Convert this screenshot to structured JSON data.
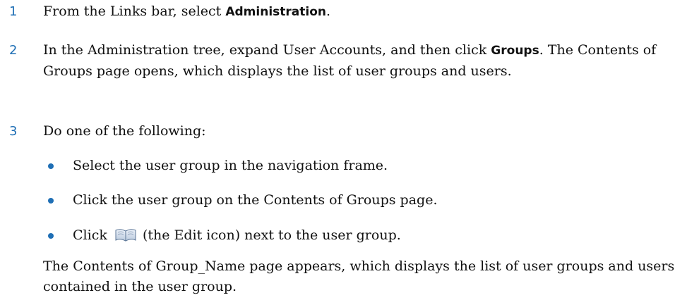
{
  "steps": [
    {
      "number": "1",
      "text_before": "From the Links bar, select ",
      "ui_term": "Administration",
      "text_after": "."
    },
    {
      "number": "2",
      "text_before": "In the Administration tree, expand User Accounts, and then click ",
      "ui_term": "Groups",
      "text_after": ". The Contents of Groups page opens, which displays the list of user groups and users."
    },
    {
      "number": "3",
      "text": "Do one of the following:"
    }
  ],
  "bullets": [
    {
      "text": "Select the user group in the navigation frame."
    },
    {
      "text": "Click the user group on the Contents of Groups page."
    },
    {
      "text_before": "Click",
      "icon": "edit-icon",
      "text_after": "(the Edit icon) next to the user group."
    }
  ],
  "result_paragraph": "The Contents of Group_Name page appears, which displays the list of user groups and users contained in the user group.",
  "colors": {
    "accent": "#1f6fb5",
    "text": "#111111",
    "background": "#ffffff"
  }
}
